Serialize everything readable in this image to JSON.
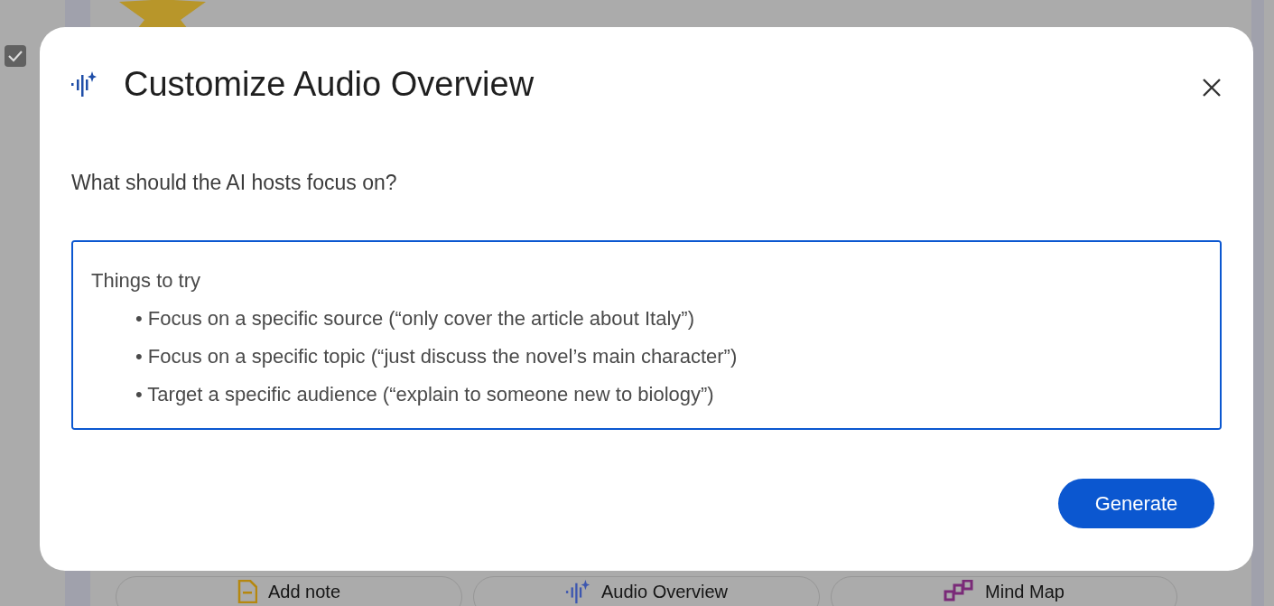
{
  "background": {
    "checkbox": {
      "checked": true
    },
    "actions": [
      {
        "kind": "note",
        "label": "Add note"
      },
      {
        "kind": "audio",
        "label": "Audio Overview"
      },
      {
        "kind": "mindmap",
        "label": "Mind Map"
      }
    ]
  },
  "dialog": {
    "title": "Customize Audio Overview",
    "prompt": "What should the AI hosts focus on?",
    "field": {
      "placeholder": "Things to try\n        • Focus on a specific source (“only cover the article about Italy”)\n        • Focus on a specific topic (“just discuss the novel’s main character”)\n        • Target a specific audience (“explain to someone new to biology”)"
    },
    "button": "Generate"
  }
}
